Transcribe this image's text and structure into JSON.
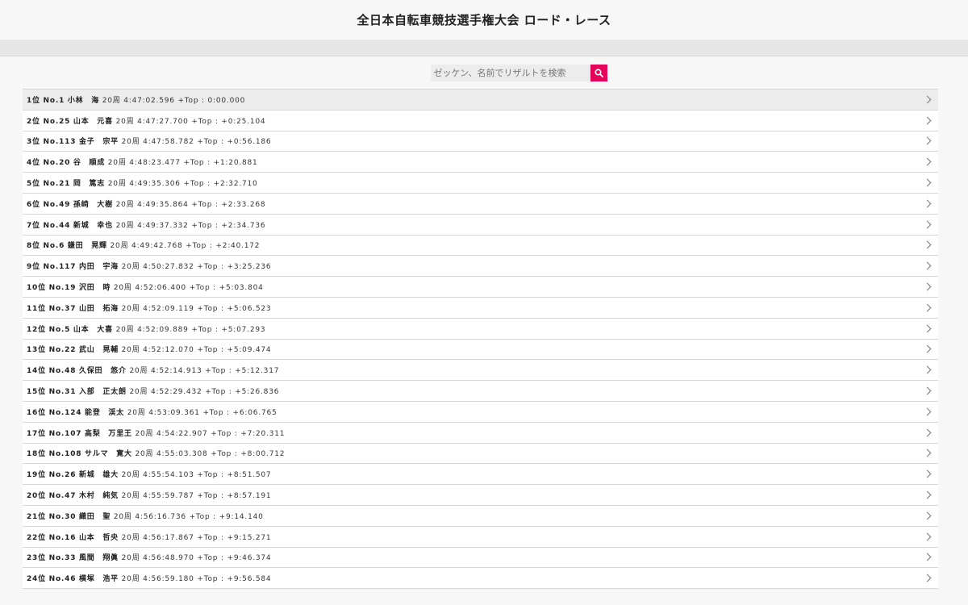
{
  "header": {
    "title": "全日本自転車競技選手権大会 ロード・レース"
  },
  "search": {
    "placeholder": "ゼッケン、名前でリザルトを検索",
    "icon": "search-icon",
    "button_color": "#e5005a"
  },
  "results": [
    {
      "rank": "1位",
      "no": "No.1",
      "name": "小林　海",
      "laps": "20周",
      "time": "4:47:02.596",
      "gap": "+Top : 0:00.000"
    },
    {
      "rank": "2位",
      "no": "No.25",
      "name": "山本　元喜",
      "laps": "20周",
      "time": "4:47:27.700",
      "gap": "+Top : +0:25.104"
    },
    {
      "rank": "3位",
      "no": "No.113",
      "name": "金子　宗平",
      "laps": "20周",
      "time": "4:47:58.782",
      "gap": "+Top : +0:56.186"
    },
    {
      "rank": "4位",
      "no": "No.20",
      "name": "谷　順成",
      "laps": "20周",
      "time": "4:48:23.477",
      "gap": "+Top : +1:20.881"
    },
    {
      "rank": "5位",
      "no": "No.21",
      "name": "岡　篤志",
      "laps": "20周",
      "time": "4:49:35.306",
      "gap": "+Top : +2:32.710"
    },
    {
      "rank": "6位",
      "no": "No.49",
      "name": "孫崎　大樹",
      "laps": "20周",
      "time": "4:49:35.864",
      "gap": "+Top : +2:33.268"
    },
    {
      "rank": "7位",
      "no": "No.44",
      "name": "新城　幸也",
      "laps": "20周",
      "time": "4:49:37.332",
      "gap": "+Top : +2:34.736"
    },
    {
      "rank": "8位",
      "no": "No.6",
      "name": "鎌田　晃輝",
      "laps": "20周",
      "time": "4:49:42.768",
      "gap": "+Top : +2:40.172"
    },
    {
      "rank": "9位",
      "no": "No.117",
      "name": "内田　宇海",
      "laps": "20周",
      "time": "4:50:27.832",
      "gap": "+Top : +3:25.236"
    },
    {
      "rank": "10位",
      "no": "No.19",
      "name": "沢田　時",
      "laps": "20周",
      "time": "4:52:06.400",
      "gap": "+Top : +5:03.804"
    },
    {
      "rank": "11位",
      "no": "No.37",
      "name": "山田　拓海",
      "laps": "20周",
      "time": "4:52:09.119",
      "gap": "+Top : +5:06.523"
    },
    {
      "rank": "12位",
      "no": "No.5",
      "name": "山本　大喜",
      "laps": "20周",
      "time": "4:52:09.889",
      "gap": "+Top : +5:07.293"
    },
    {
      "rank": "13位",
      "no": "No.22",
      "name": "武山　晃輔",
      "laps": "20周",
      "time": "4:52:12.070",
      "gap": "+Top : +5:09.474"
    },
    {
      "rank": "14位",
      "no": "No.48",
      "name": "久保田　悠介",
      "laps": "20周",
      "time": "4:52:14.913",
      "gap": "+Top : +5:12.317"
    },
    {
      "rank": "15位",
      "no": "No.31",
      "name": "入部　正太朗",
      "laps": "20周",
      "time": "4:52:29.432",
      "gap": "+Top : +5:26.836"
    },
    {
      "rank": "16位",
      "no": "No.124",
      "name": "能登　渓太",
      "laps": "20周",
      "time": "4:53:09.361",
      "gap": "+Top : +6:06.765"
    },
    {
      "rank": "17位",
      "no": "No.107",
      "name": "高梨　万里王",
      "laps": "20周",
      "time": "4:54:22.907",
      "gap": "+Top : +7:20.311"
    },
    {
      "rank": "18位",
      "no": "No.108",
      "name": "サルマ　寛大",
      "laps": "20周",
      "time": "4:55:03.308",
      "gap": "+Top : +8:00.712"
    },
    {
      "rank": "19位",
      "no": "No.26",
      "name": "新城　雄大",
      "laps": "20周",
      "time": "4:55:54.103",
      "gap": "+Top : +8:51.507"
    },
    {
      "rank": "20位",
      "no": "No.47",
      "name": "木村　純気",
      "laps": "20周",
      "time": "4:55:59.787",
      "gap": "+Top : +8:57.191"
    },
    {
      "rank": "21位",
      "no": "No.30",
      "name": "織田　聖",
      "laps": "20周",
      "time": "4:56:16.736",
      "gap": "+Top : +9:14.140"
    },
    {
      "rank": "22位",
      "no": "No.16",
      "name": "山本　哲央",
      "laps": "20周",
      "time": "4:56:17.867",
      "gap": "+Top : +9:15.271"
    },
    {
      "rank": "23位",
      "no": "No.33",
      "name": "風間　翔眞",
      "laps": "20周",
      "time": "4:56:48.970",
      "gap": "+Top : +9:46.374"
    },
    {
      "rank": "24位",
      "no": "No.46",
      "name": "横塚　浩平",
      "laps": "20周",
      "time": "4:56:59.180",
      "gap": "+Top : +9:56.584"
    }
  ]
}
